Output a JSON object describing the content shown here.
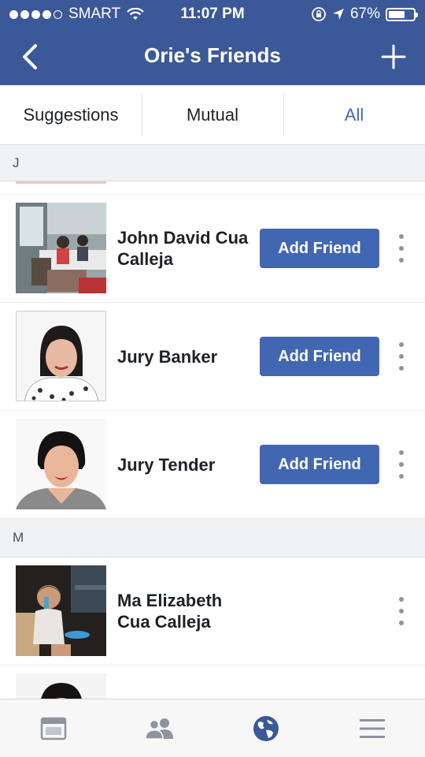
{
  "status_bar": {
    "carrier": "SMART",
    "time": "11:07 PM",
    "battery": "67%",
    "battery_level": 0.67,
    "signal_bars": 4,
    "signal_total": 5
  },
  "header": {
    "title": "Orie's Friends",
    "back_icon": "chevron-left-icon",
    "add_icon": "plus-icon",
    "color": "#3b5998"
  },
  "tabs": [
    {
      "label": "Suggestions",
      "active": false
    },
    {
      "label": "Mutual",
      "active": false
    },
    {
      "label": "All",
      "active": true
    }
  ],
  "sections": [
    {
      "letter": "J",
      "friends": [
        {
          "name": "John David Cua Calleja",
          "button": "Add Friend"
        },
        {
          "name": "Jury Banker",
          "button": "Add Friend"
        },
        {
          "name": "Jury Tender",
          "button": "Add Friend"
        }
      ]
    },
    {
      "letter": "M",
      "friends": [
        {
          "name": "Ma Elizabeth Cua Calleja",
          "button": ""
        }
      ]
    }
  ],
  "bottom_nav": [
    {
      "icon": "news-feed-icon",
      "active": false
    },
    {
      "icon": "friend-requests-icon",
      "active": false
    },
    {
      "icon": "globe-notifications-icon",
      "active": true
    },
    {
      "icon": "menu-icon",
      "active": false
    }
  ],
  "colors": {
    "brand": "#3b5998",
    "button": "#4267b2",
    "active_tab": "#4267b2"
  }
}
